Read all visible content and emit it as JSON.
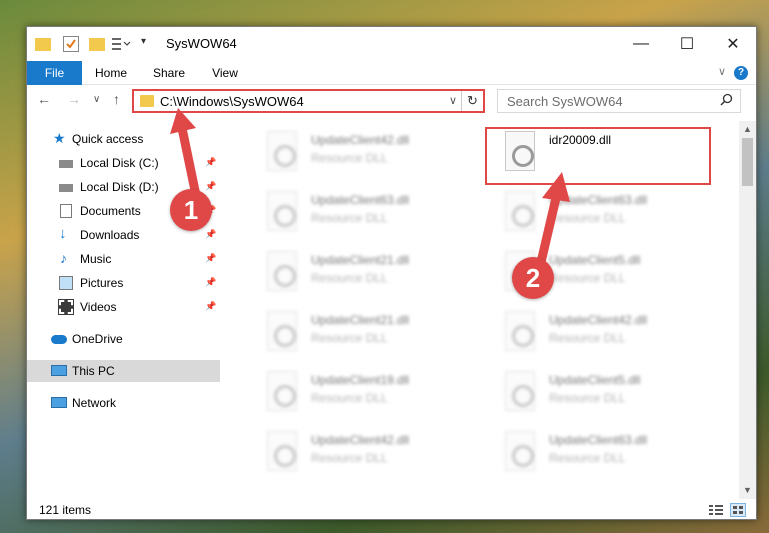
{
  "window": {
    "title": "SysWOW64"
  },
  "ribbon": {
    "tabs": [
      {
        "label": "File"
      },
      {
        "label": "Home"
      },
      {
        "label": "Share"
      },
      {
        "label": "View"
      }
    ],
    "help_label": "?"
  },
  "navigation": {
    "address_path": "C:\\Windows\\SysWOW64",
    "search_placeholder": "Search SysWOW64"
  },
  "sidebar": {
    "quick_access_label": "Quick access",
    "items": [
      {
        "label": "Local Disk (C:)",
        "icon": "drive-icon",
        "pinned": true
      },
      {
        "label": "Local Disk (D:)",
        "icon": "drive-icon",
        "pinned": true
      },
      {
        "label": "Documents",
        "icon": "documents-icon",
        "pinned": true
      },
      {
        "label": "Downloads",
        "icon": "downloads-icon",
        "pinned": true
      },
      {
        "label": "Music",
        "icon": "music-icon",
        "pinned": true
      },
      {
        "label": "Pictures",
        "icon": "pictures-icon",
        "pinned": true
      },
      {
        "label": "Videos",
        "icon": "videos-icon",
        "pinned": true
      }
    ],
    "onedrive_label": "OneDrive",
    "thispc_label": "This PC",
    "network_label": "Network"
  },
  "files": {
    "highlighted": {
      "name": "idr20009.dll",
      "type": ""
    },
    "left_column": [
      {
        "name": "UpdateClient42.dll",
        "type": "Resource DLL"
      },
      {
        "name": "UpdateClient63.dll",
        "type": "Resource DLL"
      },
      {
        "name": "UpdateClient21.dll",
        "type": "Resource DLL"
      },
      {
        "name": "UpdateClient21.dll",
        "type": "Resource DLL"
      },
      {
        "name": "UpdateClient19.dll",
        "type": "Resource DLL"
      },
      {
        "name": "UpdateClient42.dll",
        "type": "Resource DLL"
      }
    ],
    "right_column": [
      {
        "name": "UpdateClient63.dll",
        "type": "Resource DLL"
      },
      {
        "name": "UpdateClient63.dll",
        "type": "Resource DLL"
      },
      {
        "name": "UpdateClient5.dll",
        "type": "Resource DLL"
      },
      {
        "name": "UpdateClient42.dll",
        "type": "Resource DLL"
      },
      {
        "name": "UpdateClient5.dll",
        "type": "Resource DLL"
      },
      {
        "name": "UpdateClient63.dll",
        "type": "Resource DLL"
      }
    ]
  },
  "status": {
    "item_count": "121 items"
  },
  "callouts": {
    "one": "1",
    "two": "2"
  },
  "colors": {
    "accent": "#1979ca",
    "highlight": "#e04848",
    "folder": "#f2c94c"
  }
}
